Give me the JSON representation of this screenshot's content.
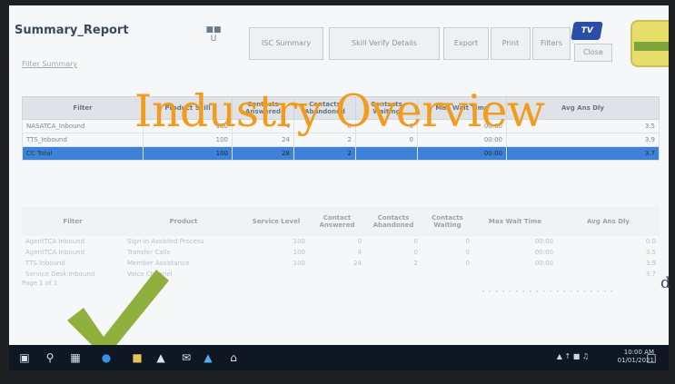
{
  "overlay_text": "Industry Overview",
  "stray_letter": "d",
  "report": {
    "title": "Summary_Report",
    "user_label": "U",
    "link": "Filter Summary",
    "buttons": [
      "ISC Summary",
      "Skill Verify Details",
      "Export",
      "Print",
      "Filters",
      "Close"
    ],
    "logo_text": "TV"
  },
  "table1": {
    "headers": [
      "Filter",
      "Product Skill",
      "Contacts Answered",
      "Contacts Abandoned",
      "Contacts Waiting",
      "Max Wait Time",
      "Avg Ans Dly"
    ],
    "rows": [
      [
        "NASATCA_Inbound",
        "100",
        "4",
        "0",
        "0",
        "00:00",
        "3.5"
      ],
      [
        "TTS_Inbound",
        "100",
        "24",
        "2",
        "0",
        "00:00",
        "3.9"
      ]
    ],
    "total": [
      "CC Total",
      "100",
      "28",
      "2",
      "",
      "00:00",
      "3.7"
    ]
  },
  "table2": {
    "headers": [
      "Filter",
      "Product",
      "Service Level",
      "Contact Answered",
      "Contacts Abandoned",
      "Contacts Waiting",
      "Max Wait Time",
      "Avg Ans Dly"
    ],
    "rows": [
      [
        "AgentTCA Inbound",
        "Sign-in Assisted Process",
        "100",
        "0",
        "0",
        "0",
        "00:00",
        "0.0"
      ],
      [
        "AgentTCA Inbound",
        "Transfer Calls",
        "100",
        "4",
        "0",
        "0",
        "00:00",
        "3.5"
      ],
      [
        "TTS Inbound",
        "Member Assistance",
        "100",
        "24",
        "2",
        "0",
        "00:00",
        "3.9"
      ],
      [
        "Service Desk Inbound",
        "Voice Channel",
        "",
        "",
        "",
        "",
        "",
        "3.7"
      ]
    ]
  },
  "footer_text": "Page 1 of 1",
  "taskbar": {
    "clock_time": "10:00 AM",
    "clock_date": "01/01/2021"
  },
  "colors": {
    "overlay": "#f19c1c",
    "check": "#8fb03c",
    "total_row": "#3d82d6"
  },
  "icons": [
    "windows-icon",
    "search-icon",
    "task-view-icon",
    "edge-icon",
    "file-explorer-icon",
    "store-icon",
    "mail-icon",
    "photos-icon",
    "notification-icon"
  ]
}
